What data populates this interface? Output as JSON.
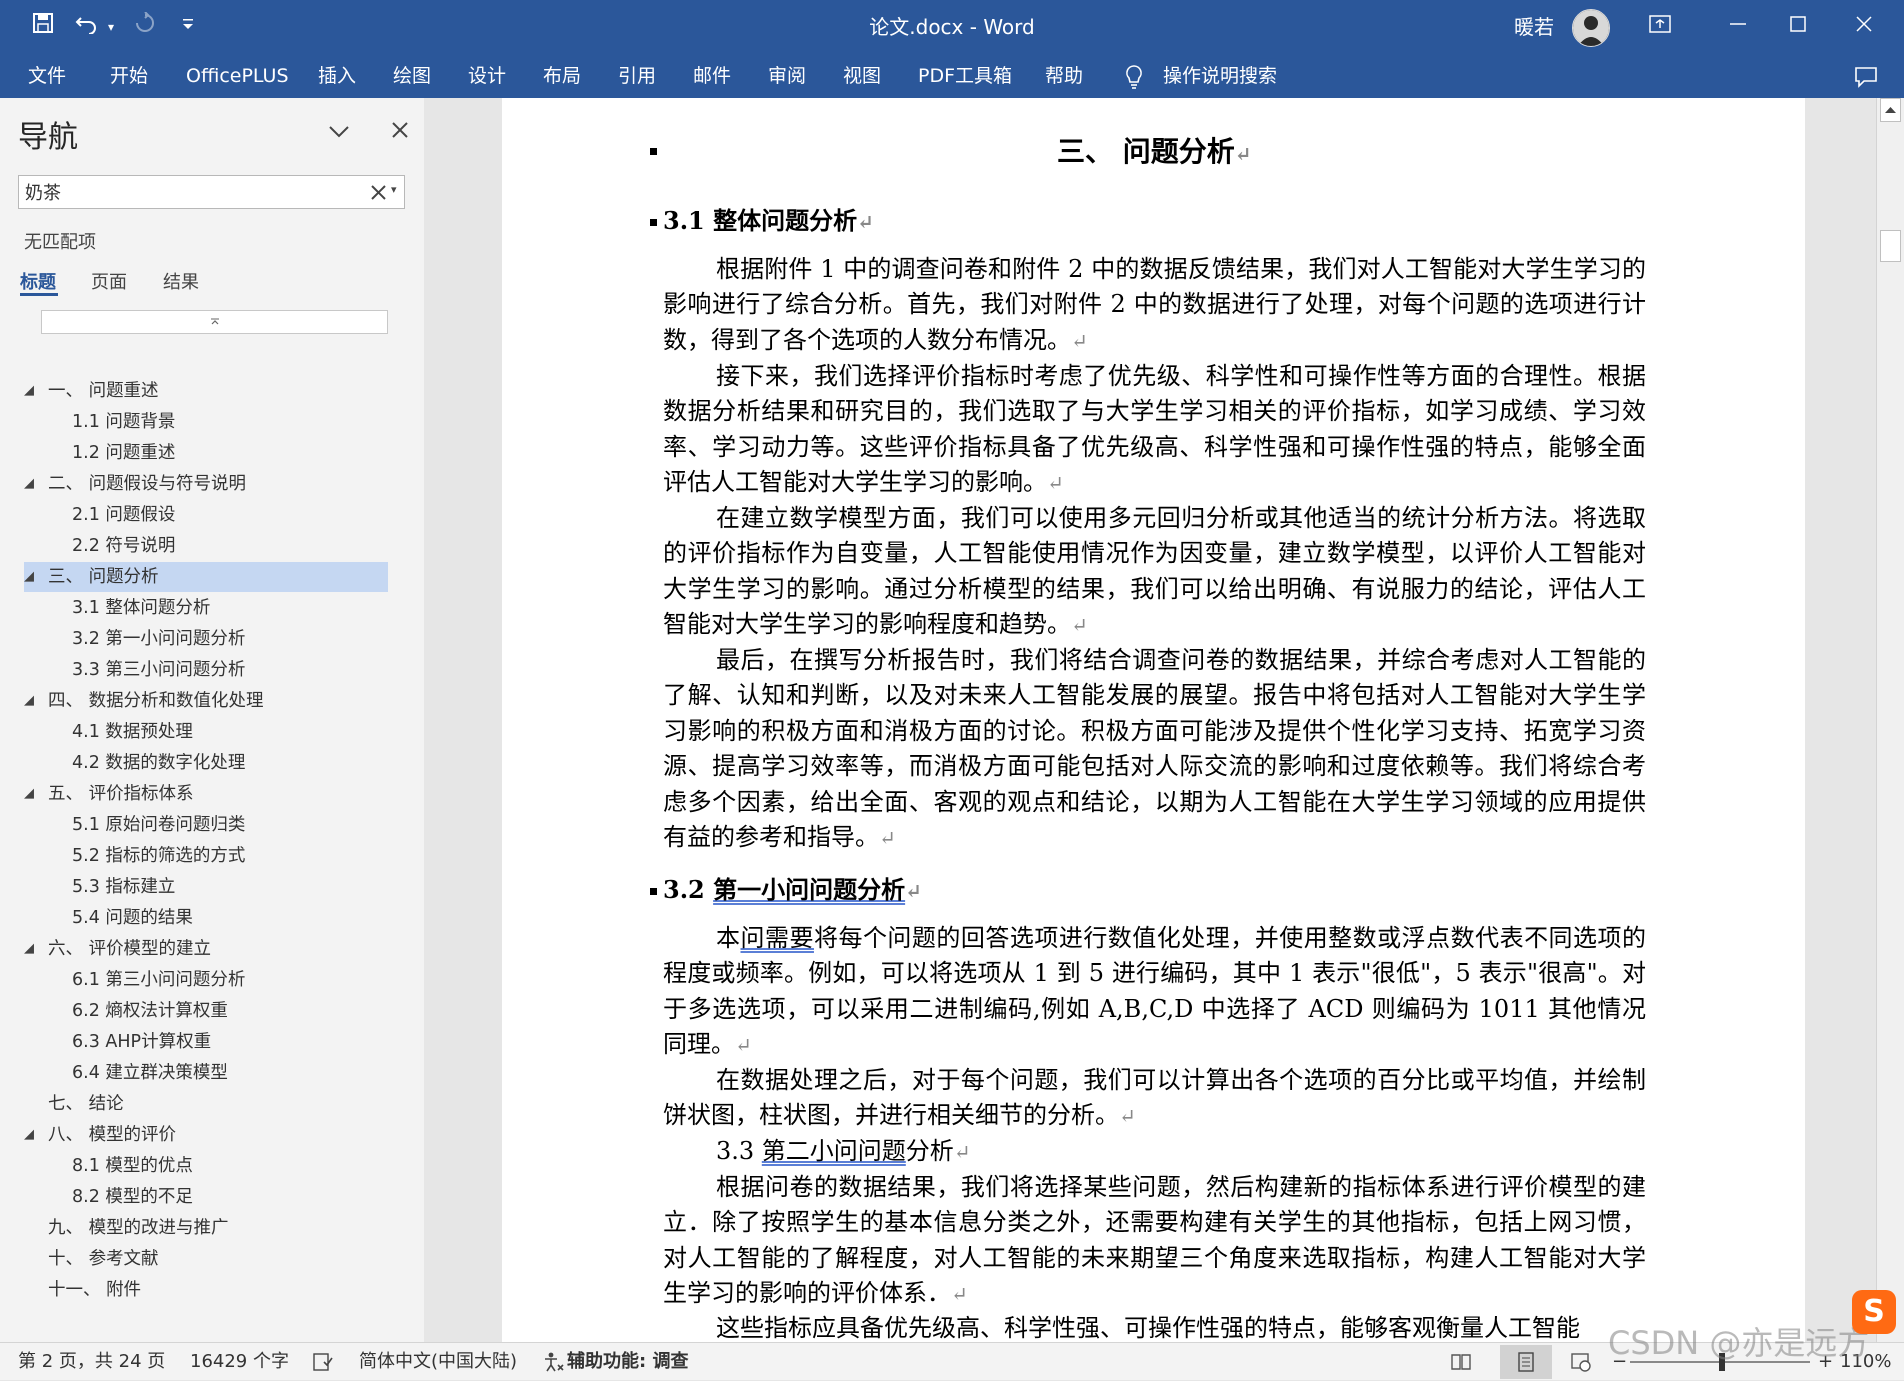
{
  "window": {
    "doc_title": "论文.docx  -  Word",
    "user_name": "暖若"
  },
  "ribbon": {
    "tabs": [
      "文件",
      "开始",
      "OfficePLUS",
      "插入",
      "绘图",
      "设计",
      "布局",
      "引用",
      "邮件",
      "审阅",
      "视图",
      "PDF工具箱",
      "帮助"
    ],
    "search_label": "操作说明搜索"
  },
  "nav": {
    "title": "导航",
    "search_value": "奶茶",
    "no_match": "无匹配项",
    "tabs": [
      "标题",
      "页面",
      "结果"
    ],
    "active_tab": "标题",
    "items": [
      {
        "text": "一、 问题重述",
        "level": 1,
        "expanded": true
      },
      {
        "text": "1.1 问题背景",
        "level": 2
      },
      {
        "text": "1.2 问题重述",
        "level": 2
      },
      {
        "text": "二、 问题假设与符号说明",
        "level": 1,
        "expanded": true
      },
      {
        "text": "2.1 问题假设",
        "level": 2
      },
      {
        "text": "2.2 符号说明",
        "level": 2
      },
      {
        "text": "三、 问题分析",
        "level": 1,
        "expanded": true,
        "selected": true
      },
      {
        "text": "3.1 整体问题分析",
        "level": 2
      },
      {
        "text": "3.2 第一小问问题分析",
        "level": 2
      },
      {
        "text": "3.3 第三小问问题分析",
        "level": 2
      },
      {
        "text": "四、 数据分析和数值化处理",
        "level": 1,
        "expanded": true
      },
      {
        "text": "4.1 数据预处理",
        "level": 2
      },
      {
        "text": "4.2 数据的数字化处理",
        "level": 2
      },
      {
        "text": "五、 评价指标体系",
        "level": 1,
        "expanded": true
      },
      {
        "text": "5.1 原始问卷问题归类",
        "level": 2
      },
      {
        "text": "5.2 指标的筛选的方式",
        "level": 2
      },
      {
        "text": "5.3 指标建立",
        "level": 2
      },
      {
        "text": "5.4 问题的结果",
        "level": 2
      },
      {
        "text": "六、 评价模型的建立",
        "level": 1,
        "expanded": true
      },
      {
        "text": "6.1 第三小问问题分析",
        "level": 2
      },
      {
        "text": "6.2 熵权法计算权重",
        "level": 2
      },
      {
        "text": "6.3 AHP计算权重",
        "level": 2
      },
      {
        "text": "6.4 建立群决策模型",
        "level": 2
      },
      {
        "text": "七、 结论",
        "level": 1
      },
      {
        "text": "八、 模型的评价",
        "level": 1,
        "expanded": true
      },
      {
        "text": "8.1 模型的优点",
        "level": 2
      },
      {
        "text": "8.2 模型的不足",
        "level": 2
      },
      {
        "text": "九、 模型的改进与推广",
        "level": 1
      },
      {
        "text": "十、 参考文献",
        "level": 1
      },
      {
        "text": "十一、 附件",
        "level": 1
      }
    ]
  },
  "document": {
    "chapter_title": "三、 问题分析",
    "h31": "3.1 整体问题分析",
    "p1": "根据附件 1 中的调查问卷和附件 2 中的数据反馈结果，我们对人工智能对大学生学习的影响进行了综合分析。首先，我们对附件 2 中的数据进行了处理，对每个问题的选项进行计数，得到了各个选项的人数分布情况。",
    "p2": "接下来，我们选择评价指标时考虑了优先级、科学性和可操作性等方面的合理性。根据数据分析结果和研究目的，我们选取了与大学生学习相关的评价指标，如学习成绩、学习效率、学习动力等。这些评价指标具备了优先级高、科学性强和可操作性强的特点，能够全面评估人工智能对大学生学习的影响。",
    "p3": "在建立数学模型方面，我们可以使用多元回归分析或其他适当的统计分析方法。将选取的评价指标作为自变量，人工智能使用情况作为因变量，建立数学模型，以评价人工智能对大学生学习的影响。通过分析模型的结果，我们可以给出明确、有说服力的结论，评估人工智能对大学生学习的影响程度和趋势。",
    "p4": "最后，在撰写分析报告时，我们将结合调查问卷的数据结果，并综合考虑对人工智能的了解、认知和判断，以及对未来人工智能发展的展望。报告中将包括对人工智能对大学生学习影响的积极方面和消极方面的讨论。积极方面可能涉及提供个性化学习支持、拓宽学习资源、提高学习效率等，而消极方面可能包括对人际交流的影响和过度依赖等。我们将综合考虑多个因素，给出全面、客观的观点和结论，以期为人工智能在大学生学习领域的应用提供有益的参考和指导。",
    "h32_num": "3.2 ",
    "h32_text": "第一小问问题分析",
    "p5_a": "本",
    "p5_b": "问需要",
    "p5_c": "将每个问题的回答选项进行数值化处理，并使用整数或浮点数代表不同选项的程度或频率。例如，可以将选项从 1 到 5 进行编码，其中 1 表示\"很低\"，5 表示\"很高\"。对于多选选项，可以采用二进制编码,例如 A,B,C,D 中选择了 ACD 则编码为 1011 其他情况同理。",
    "p6": "在数据处理之后，对于每个问题，我们可以计算出各个选项的百分比或平均值，并绘制饼状图，柱状图，并进行相关细节的分析。",
    "h33_num": "3.3 ",
    "h33_text": "第二小问问题",
    "h33_tail": "分析",
    "p7": "根据问卷的数据结果，我们将选择某些问题，然后构建新的指标体系进行评价模型的建立．除了按照学生的基本信息分类之外，还需要构建有关学生的其他指标，包括上网习惯，对人工智能的了解程度，对人工智能的未来期望三个角度来选取指标，构建人工智能对大学生学习的影响的评价体系．",
    "p8": "这些指标应具备优先级高、科学性强、可操作性强的特点，能够客观衡量人工智能"
  },
  "status": {
    "page": "第 2 页，共 24 页",
    "words": "16429 个字",
    "language": "简体中文(中国大陆)",
    "accessibility": "辅助功能: 调查",
    "zoom": "110%",
    "watermark": "CSDN @亦是远方"
  },
  "colors": {
    "ribbon": "#2b579a",
    "selected_nav": "#c5d7f2",
    "active_tab": "#2b579a"
  }
}
